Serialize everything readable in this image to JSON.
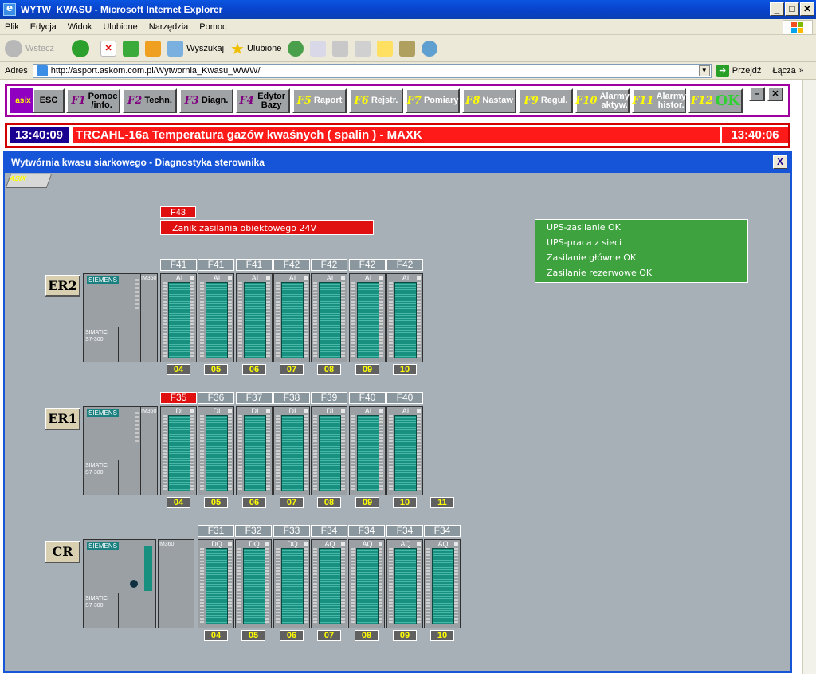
{
  "window": {
    "title": "WYTW_KWASU - Microsoft Internet Explorer"
  },
  "menu": [
    "Plik",
    "Edycja",
    "Widok",
    "Ulubione",
    "Narzędzia",
    "Pomoc"
  ],
  "toolbar": {
    "back": "Wstecz",
    "search": "Wyszukaj",
    "favorites": "Ulubione"
  },
  "address": {
    "label": "Adres",
    "url": "http://asport.askom.com.pl/Wytwornia_Kwasu_WWW/",
    "go": "Przejdź",
    "links": "Łącza"
  },
  "fkeys": {
    "esc": "ESC",
    "f1": {
      "fn": "F1",
      "label": "Pomoc /info."
    },
    "f2": {
      "fn": "F2",
      "label": "Techn."
    },
    "f3": {
      "fn": "F3",
      "label": "Diagn."
    },
    "f4": {
      "fn": "F4",
      "label": "Edytor Bazy"
    },
    "f5": {
      "fn": "F5",
      "label": "Raport"
    },
    "f6": {
      "fn": "F6",
      "label": "Rejstr."
    },
    "f7": {
      "fn": "F7",
      "label": "Pomiary"
    },
    "f8": {
      "fn": "F8",
      "label": "Nastaw"
    },
    "f9": {
      "fn": "F9",
      "label": "Regul."
    },
    "f10": {
      "fn": "F10",
      "label": "Alarmy aktyw."
    },
    "f11": {
      "fn": "F11",
      "label": "Alarmy histor."
    },
    "f12": {
      "fn": "F12",
      "label": "OK"
    },
    "logo": "asix"
  },
  "alarm": {
    "time_left": "13:40:09",
    "message": "TRCAHL-16a  Temperatura gazów kwaśnych  ( spalin ) - MAXK",
    "time_right": "13:40:06"
  },
  "inner": {
    "title": "Wytwórnia kwasu siarkowego - Diagnostyka sterownika",
    "close": "X",
    "logo": "ASIX"
  },
  "fault": {
    "tag": "F43",
    "message": "Zanik zasilania obiektowego 24V"
  },
  "status": [
    "UPS-zasilanie OK",
    "UPS-praca z sieci",
    "Zasilanie główne OK",
    "Zasilanie rezerwowe OK"
  ],
  "cpu": {
    "brand": "SIEMENS",
    "model": "SIMATIC S7-300",
    "im": "IM360"
  },
  "racks": [
    {
      "name": "ER2",
      "modules": [
        {
          "fuse": "F41",
          "type": "AI",
          "slot": "04",
          "fault": false
        },
        {
          "fuse": "F41",
          "type": "AI",
          "slot": "05",
          "fault": false
        },
        {
          "fuse": "F41",
          "type": "AI",
          "slot": "06",
          "fault": false
        },
        {
          "fuse": "F42",
          "type": "AI",
          "slot": "07",
          "fault": false
        },
        {
          "fuse": "F42",
          "type": "AI",
          "slot": "08",
          "fault": false
        },
        {
          "fuse": "F42",
          "type": "AI",
          "slot": "09",
          "fault": false
        },
        {
          "fuse": "F42",
          "type": "AI",
          "slot": "10",
          "fault": false
        }
      ]
    },
    {
      "name": "ER1",
      "modules": [
        {
          "fuse": "F35",
          "type": "DI",
          "slot": "04",
          "fault": true
        },
        {
          "fuse": "F36",
          "type": "DI",
          "slot": "05",
          "fault": false
        },
        {
          "fuse": "F37",
          "type": "DI",
          "slot": "06",
          "fault": false
        },
        {
          "fuse": "F38",
          "type": "DI",
          "slot": "07",
          "fault": false
        },
        {
          "fuse": "F39",
          "type": "DI",
          "slot": "08",
          "fault": false
        },
        {
          "fuse": "F40",
          "type": "AI",
          "slot": "09",
          "fault": false
        },
        {
          "fuse": "F40",
          "type": "AI",
          "slot": "10",
          "fault": false
        }
      ],
      "extra_slot": "11"
    },
    {
      "name": "CR",
      "modules": [
        {
          "fuse": "F31",
          "type": "DQ",
          "slot": "04",
          "fault": false
        },
        {
          "fuse": "F32",
          "type": "DQ",
          "slot": "05",
          "fault": false
        },
        {
          "fuse": "F33",
          "type": "DQ",
          "slot": "06",
          "fault": false
        },
        {
          "fuse": "F34",
          "type": "AQ",
          "slot": "07",
          "fault": false
        },
        {
          "fuse": "F34",
          "type": "AQ",
          "slot": "08",
          "fault": false
        },
        {
          "fuse": "F34",
          "type": "AQ",
          "slot": "09",
          "fault": false
        },
        {
          "fuse": "F34",
          "type": "AQ",
          "slot": "10",
          "fault": false
        }
      ]
    }
  ],
  "colors": {
    "fault": "#e01010",
    "ok": "#3ea23e",
    "alarm": "#ff1a1a",
    "frame": "#a000a0",
    "panel": "#a7b0b6"
  }
}
